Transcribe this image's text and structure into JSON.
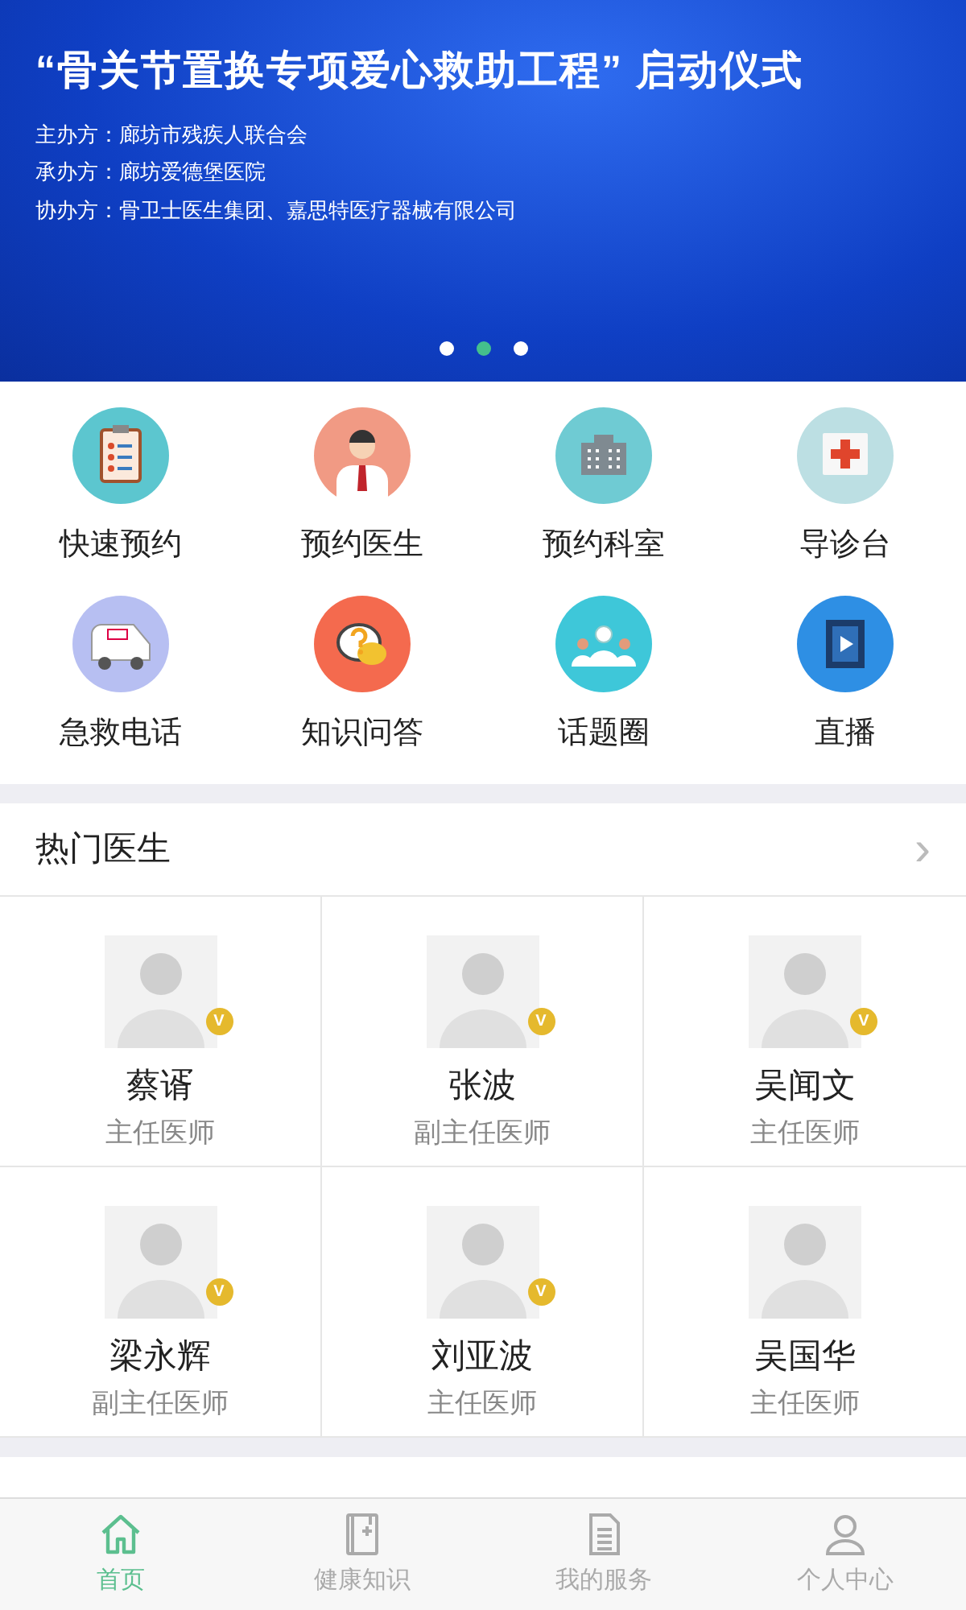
{
  "banner": {
    "title": "“骨关节置换专项爱心救助工程”  启动仪式",
    "lines": [
      "主办方：廊坊市残疾人联合会",
      "承办方：廊坊爱德堡医院",
      "协办方：骨卫士医生集团、嘉思特医疗器械有限公司"
    ],
    "dots": [
      {
        "selected": false
      },
      {
        "selected": true
      },
      {
        "selected": false
      }
    ]
  },
  "shortcuts": [
    {
      "label": "快速预约",
      "color": "#5cc6cf"
    },
    {
      "label": "预约医生",
      "color": "#f19a84"
    },
    {
      "label": "预约科室",
      "color": "#6fcbd3"
    },
    {
      "label": "导诊台",
      "color": "#bcdfe3"
    },
    {
      "label": "急救电话",
      "color": "#b7bff2"
    },
    {
      "label": "知识问答",
      "color": "#f46a4e"
    },
    {
      "label": "话题圈",
      "color": "#3ec7d9"
    },
    {
      "label": "直播",
      "color": "#2e8fe4"
    }
  ],
  "hot_doctors": {
    "title": "热门医生",
    "more": "›",
    "doctors": [
      {
        "name": "蔡谞",
        "title": "主任医师",
        "badge": "V"
      },
      {
        "name": "张波",
        "title": "副主任医师",
        "badge": "V"
      },
      {
        "name": "吴闻文",
        "title": "主任医师",
        "badge": "V"
      },
      {
        "name": "梁永辉",
        "title": "副主任医师",
        "badge": "V"
      },
      {
        "name": "刘亚波",
        "title": "主任医师",
        "badge": "V"
      },
      {
        "name": "吴国华",
        "title": "主任医师"
      }
    ]
  },
  "tab_bar": [
    {
      "label": "首页",
      "selected": true
    },
    {
      "label": "健康知识",
      "selected": false
    },
    {
      "label": "我的服务",
      "selected": false
    },
    {
      "label": "个人中心",
      "selected": false
    }
  ]
}
